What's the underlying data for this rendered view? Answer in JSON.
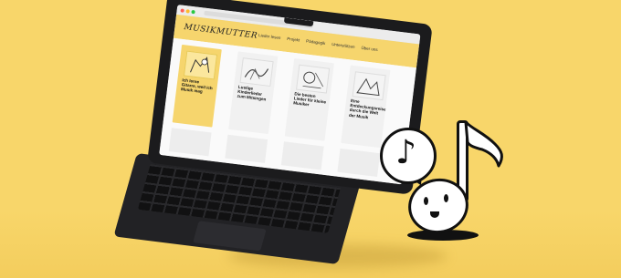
{
  "site": {
    "logo": "MUSIKMUTTER",
    "nav": [
      "Lieder lesen",
      "Projekt",
      "Pädagogik",
      "Unterstützen",
      "Über uns"
    ]
  },
  "cards": [
    {
      "text": "Ich lerne Gitarre, weil ich Musik mag",
      "style": "yellow"
    },
    {
      "text": "Lustige Kinderlieder zum Mitsingen",
      "style": "plain"
    },
    {
      "text": "Die besten Lieder für kleine Musiker",
      "style": "plain"
    },
    {
      "text": "Eine Entdeckungsreise durch die Welt der Musik",
      "style": "plain"
    }
  ],
  "colors": {
    "background": "#f8d66a",
    "accent": "#f6d56d",
    "laptop": "#1b1b1d"
  },
  "icons": [
    "music-note-icon",
    "eighth-note-character-icon"
  ]
}
